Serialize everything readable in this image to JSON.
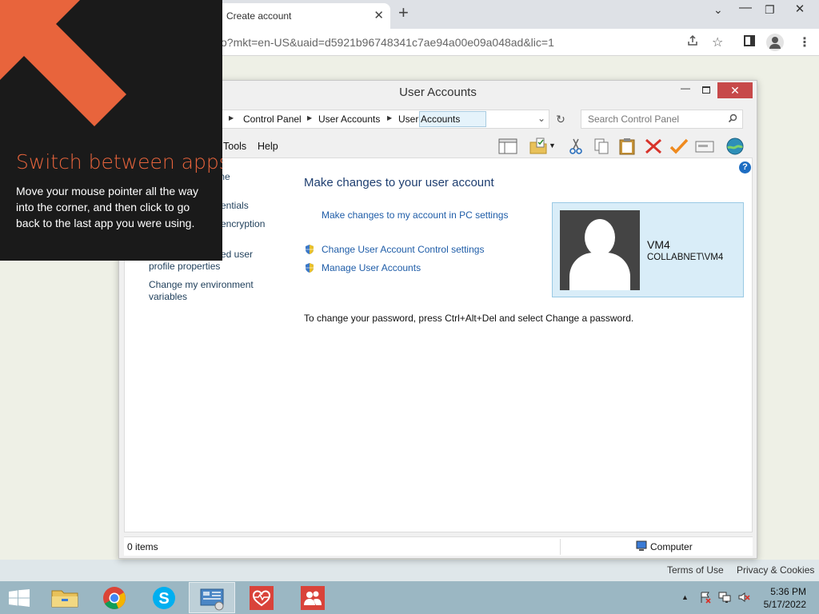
{
  "browser": {
    "tab_title": "Create account",
    "tab_close": "✕",
    "new_tab": "+",
    "url": "o?mkt=en-US&uaid=d5921b96748341c7ae94a00e09a048ad&lic=1",
    "minimize": "⌄",
    "restore": "❐",
    "close": "✕",
    "footer": {
      "terms": "Terms of Use",
      "privacy": "Privacy & Cookies"
    }
  },
  "window": {
    "title": "User Accounts",
    "close": "✕",
    "minimize": "—",
    "breadcrumb": [
      "Control Panel",
      "User Accounts",
      "User Accounts"
    ],
    "search_placeholder": "Search Control Panel",
    "menu": [
      "Tools",
      "Help"
    ],
    "help": "?"
  },
  "sidebar": {
    "items": [
      "me",
      "entials",
      "encryption",
      "ed user",
      "profile properties",
      "Change my environment",
      "variables"
    ]
  },
  "main": {
    "heading": "Make changes to your user account",
    "pc_settings_link": "Make changes to my account in PC settings",
    "uac_link": "Change User Account Control settings",
    "manage_link": "Manage User Accounts",
    "password_note": "To change your password, press Ctrl+Alt+Del and select Change a password."
  },
  "user": {
    "name": "VM4",
    "domain": "COLLABNET\\VM4"
  },
  "status": {
    "items": "0 items",
    "location": "Computer"
  },
  "overlay": {
    "title": "Switch between apps",
    "text": "Move your mouse pointer all the way into the corner, and then click to go back to the last app you were using."
  },
  "taskbar": {
    "time": "5:36 PM",
    "date": "5/17/2022",
    "tray_expand": "▲"
  },
  "colors": {
    "overlay_accent": "#e8643c",
    "link": "#1f5da8",
    "taskbar": "#9bb7c3",
    "close_button": "#c7494a"
  }
}
